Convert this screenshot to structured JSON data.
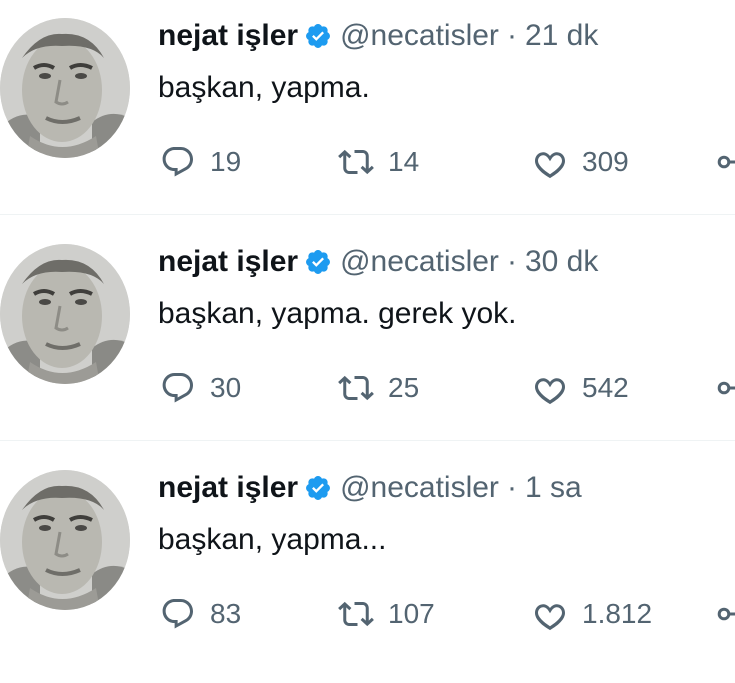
{
  "tweets": [
    {
      "name": "nejat işler",
      "handle": "@necatisler",
      "separator": "·",
      "time": "21 dk",
      "text": "başkan, yapma.",
      "replies": "19",
      "retweets": "14",
      "likes": "309"
    },
    {
      "name": "nejat işler",
      "handle": "@necatisler",
      "separator": "·",
      "time": "30 dk",
      "text": "başkan, yapma. gerek yok.",
      "replies": "30",
      "retweets": "25",
      "likes": "542"
    },
    {
      "name": "nejat işler",
      "handle": "@necatisler",
      "separator": "·",
      "time": "1 sa",
      "text": "başkan, yapma...",
      "replies": "83",
      "retweets": "107",
      "likes": "1.812"
    }
  ],
  "icons": {
    "verified": "verified-badge-icon",
    "reply": "reply-icon",
    "retweet": "retweet-icon",
    "like": "like-icon",
    "share": "share-icon"
  },
  "colors": {
    "verified": "#1d9bf0",
    "text": "#0f1419",
    "secondary": "#536471",
    "divider": "#eff3f4"
  }
}
